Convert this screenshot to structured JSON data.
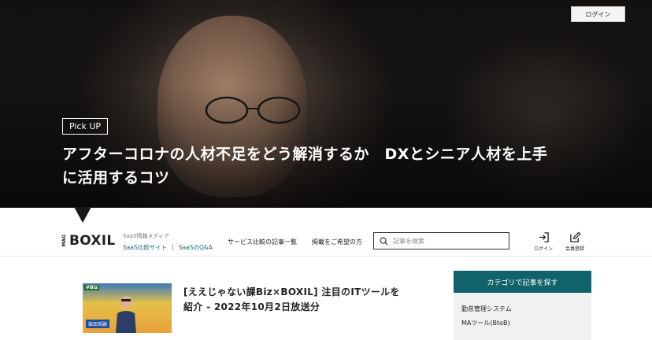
{
  "hero": {
    "login_label": "ログイン",
    "badge": "Pick UP",
    "title": "アフターコロナの人材不足をどう解消するか　DXとシニア人材を上手\nに活用するコツ"
  },
  "header": {
    "logo_small": "MAG",
    "logo_text": "BOXIL",
    "tagline": "SaaS情報メディア",
    "sublink_1": "SaaS比較サイト",
    "sublink_sep": "|",
    "sublink_2": "SaaSのQ&A",
    "nav_1": "サービス比較の記事一覧",
    "nav_2": "掲載をご希望の方",
    "search_placeholder": "記事を検索",
    "login_label": "ログイン",
    "register_label": "会員登録"
  },
  "article": {
    "thumb_tag": "#Biz",
    "thumb_name": "柴田英嗣",
    "title": "[ええじゃない課Biz×BOXIL] 注目のITツールを\n紹介 - 2022年10月2日放送分"
  },
  "sidebar": {
    "heading": "カテゴリで記事を探す",
    "items": [
      "勤怠管理システム",
      "MAツール(BtoB)"
    ]
  },
  "colors": {
    "accent": "#10636a",
    "link": "#1a6e73"
  }
}
